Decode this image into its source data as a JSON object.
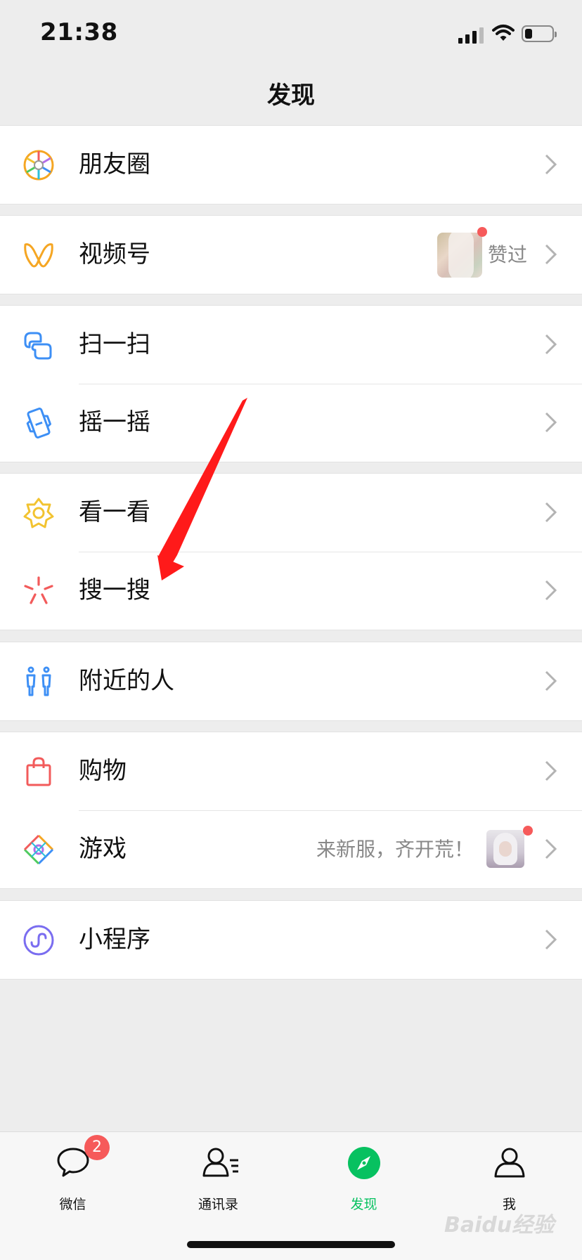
{
  "status": {
    "time": "21:38"
  },
  "nav": {
    "title": "发现"
  },
  "groups": [
    {
      "items": [
        {
          "label": "朋友圈",
          "icon": "moments-icon"
        }
      ]
    },
    {
      "items": [
        {
          "label": "视频号",
          "icon": "channels-icon",
          "extra": "赞过"
        }
      ]
    },
    {
      "items": [
        {
          "label": "扫一扫",
          "icon": "scan-icon"
        },
        {
          "label": "摇一摇",
          "icon": "shake-icon"
        }
      ]
    },
    {
      "items": [
        {
          "label": "看一看",
          "icon": "top-stories-icon"
        },
        {
          "label": "搜一搜",
          "icon": "search-icon"
        }
      ]
    },
    {
      "items": [
        {
          "label": "附近的人",
          "icon": "people-nearby-icon"
        }
      ]
    },
    {
      "items": [
        {
          "label": "购物",
          "icon": "shopping-bag-icon"
        },
        {
          "label": "游戏",
          "icon": "games-icon",
          "extra": "来新服，齐开荒！"
        }
      ]
    },
    {
      "items": [
        {
          "label": "小程序",
          "icon": "mini-programs-icon"
        }
      ]
    }
  ],
  "tabbar": {
    "tabs": [
      {
        "label": "微信",
        "badge": "2",
        "icon": "chats-icon"
      },
      {
        "label": "通讯录",
        "icon": "contacts-icon"
      },
      {
        "label": "发现",
        "icon": "discover-icon",
        "active": true
      },
      {
        "label": "我",
        "icon": "me-icon"
      }
    ]
  },
  "watermark": "Baidu经验",
  "colors": {
    "accent": "#07c160",
    "badge": "#f65a5a",
    "annotation_arrow": "#ff1a1a"
  }
}
